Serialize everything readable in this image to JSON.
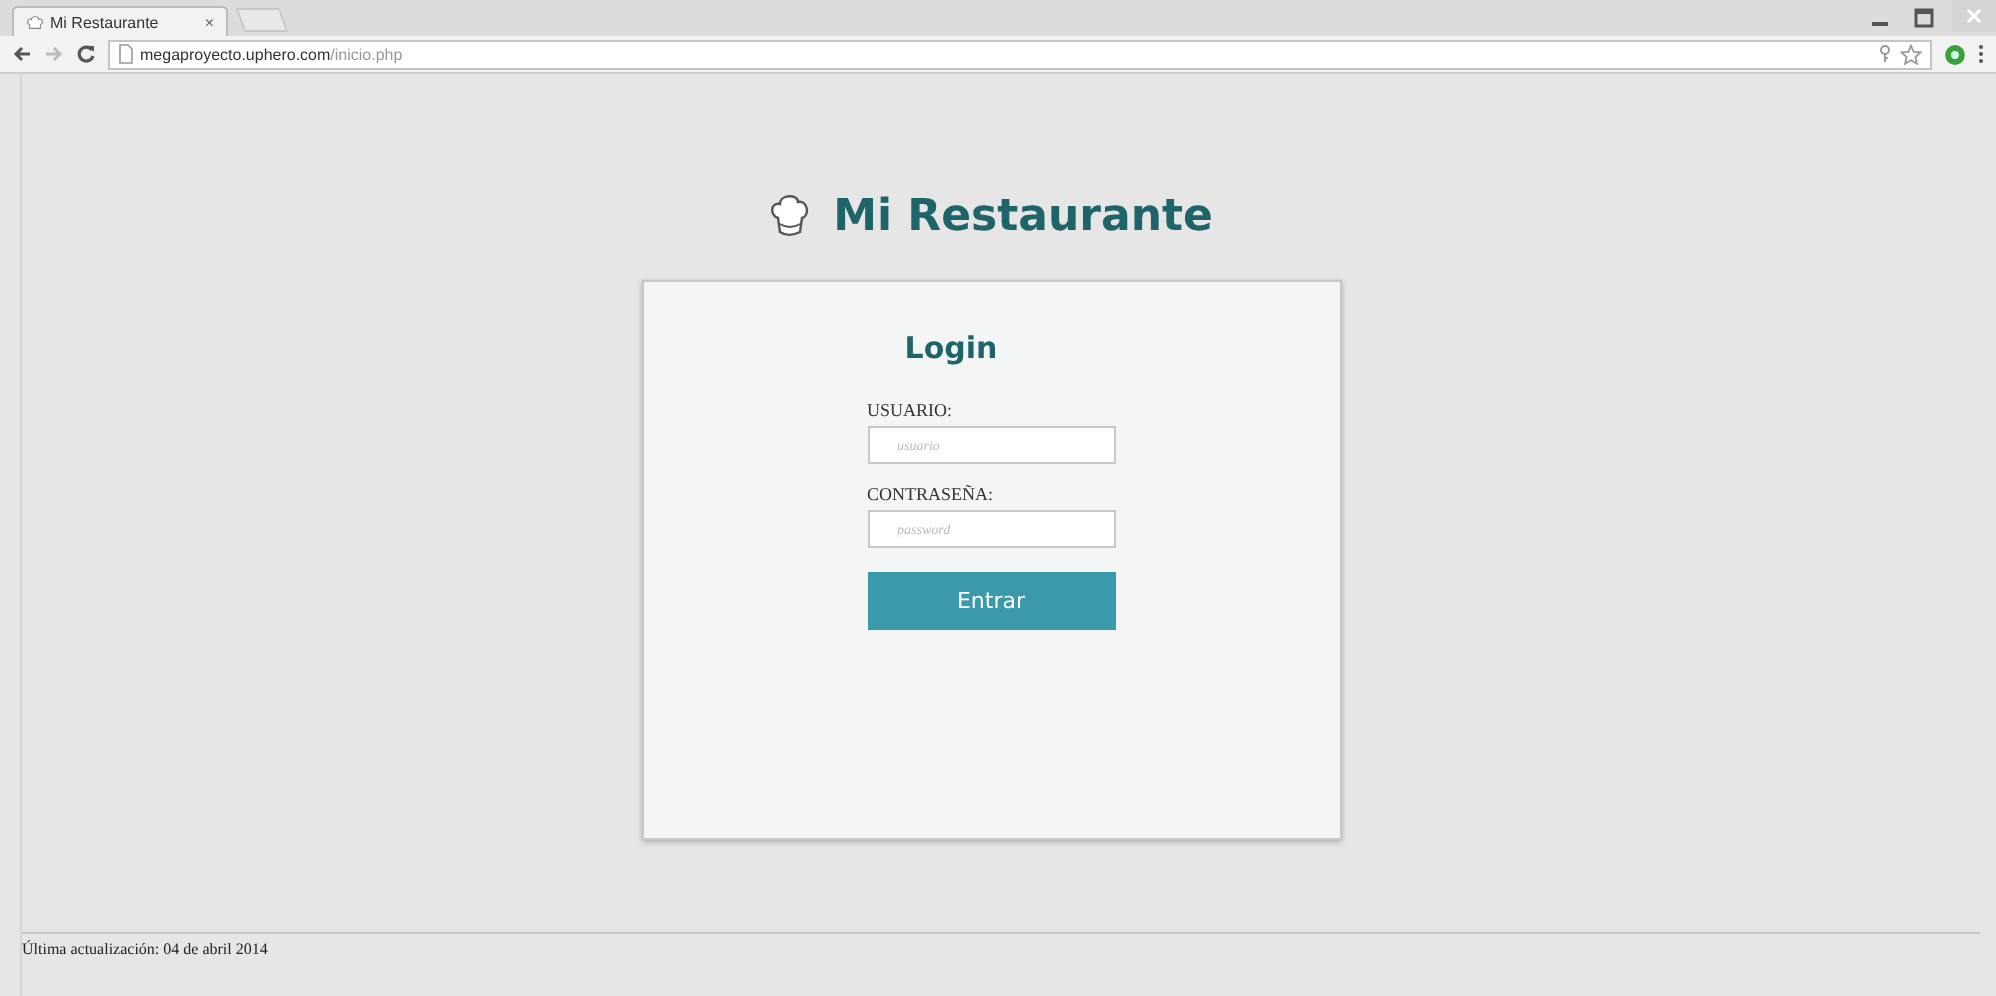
{
  "browser": {
    "tab_title": "Mi Restaurante",
    "tab_close": "×",
    "url_host": "megaproyecto.uphero.com",
    "url_path": "/inicio.php"
  },
  "header": {
    "title": "Mi Restaurante"
  },
  "login": {
    "title": "Login",
    "fields": [
      {
        "label": "USUARIO:",
        "placeholder": "usuario"
      },
      {
        "label": "CONTRASEÑA:",
        "placeholder": "password"
      }
    ],
    "submit": "Entrar"
  },
  "footer": {
    "text": "Última actualización: 04 de abril 2014"
  }
}
